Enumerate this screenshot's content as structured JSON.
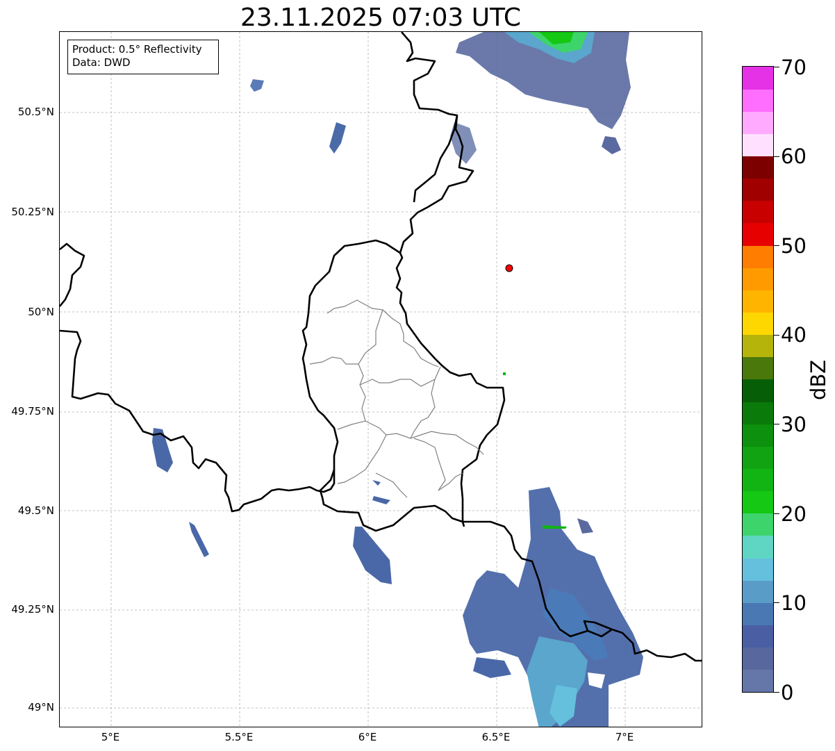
{
  "title": "23.11.2025 07:03 UTC",
  "info_box": {
    "line1": "Product: 0.5° Reflectivity",
    "line2": "Data: DWD"
  },
  "lat_labels": [
    "50.5°N",
    "50.25°N",
    "50°N",
    "49.75°N",
    "49.5°N",
    "49.25°N",
    "49°N"
  ],
  "lon_labels": [
    "5°E",
    "5.5°E",
    "6°E",
    "6.5°E",
    "7°E"
  ],
  "colorbar": {
    "unit": "dBZ",
    "tick_labels": [
      "0",
      "10",
      "20",
      "30",
      "40",
      "50",
      "60",
      "70"
    ],
    "colors": [
      "#6576a8",
      "#58689e",
      "#4a5fa3",
      "#4a78b3",
      "#5a9cc8",
      "#64c0dc",
      "#5fd6c4",
      "#3ed46c",
      "#14c814",
      "#12b414",
      "#11a311",
      "#0d900d",
      "#0a7a0a",
      "#065f06",
      "#4a780a",
      "#b4b40a",
      "#ffd700",
      "#ffb400",
      "#ff9b00",
      "#ff7d00",
      "#e60000",
      "#c80000",
      "#a00000",
      "#7d0000",
      "#ffe1ff",
      "#ffaaff",
      "#ff6eff",
      "#e632e6"
    ]
  },
  "station_marker": {
    "color": "#ff0000"
  }
}
